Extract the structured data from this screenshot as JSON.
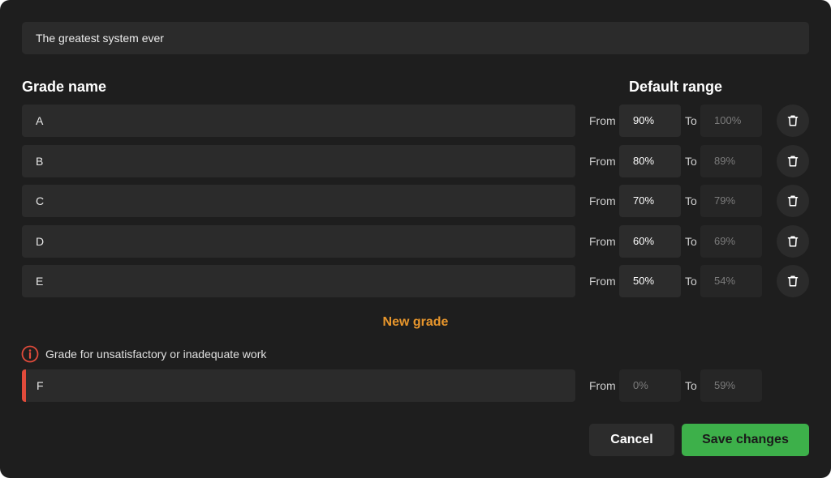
{
  "system": {
    "name": "The greatest system ever"
  },
  "headers": {
    "grade_name": "Grade name",
    "default_range": "Default range"
  },
  "labels": {
    "from": "From",
    "to": "To"
  },
  "grades": [
    {
      "name": "A",
      "from": "90%",
      "to": "100%"
    },
    {
      "name": "B",
      "from": "80%",
      "to": "89%"
    },
    {
      "name": "C",
      "from": "70%",
      "to": "79%"
    },
    {
      "name": "D",
      "from": "60%",
      "to": "69%"
    },
    {
      "name": "E",
      "from": "50%",
      "to": "54%"
    }
  ],
  "new_grade_label": "New grade",
  "failing": {
    "note": "Grade for unsatisfactory or inadequate work",
    "name": "F",
    "from": "0%",
    "to": "59%"
  },
  "actions": {
    "cancel": "Cancel",
    "save": "Save changes"
  },
  "colors": {
    "accent": "#e8962c",
    "danger": "#e14b3b",
    "save": "#3db04a"
  },
  "icons": {
    "delete": "trash-icon",
    "warning": "info-circle-icon"
  }
}
